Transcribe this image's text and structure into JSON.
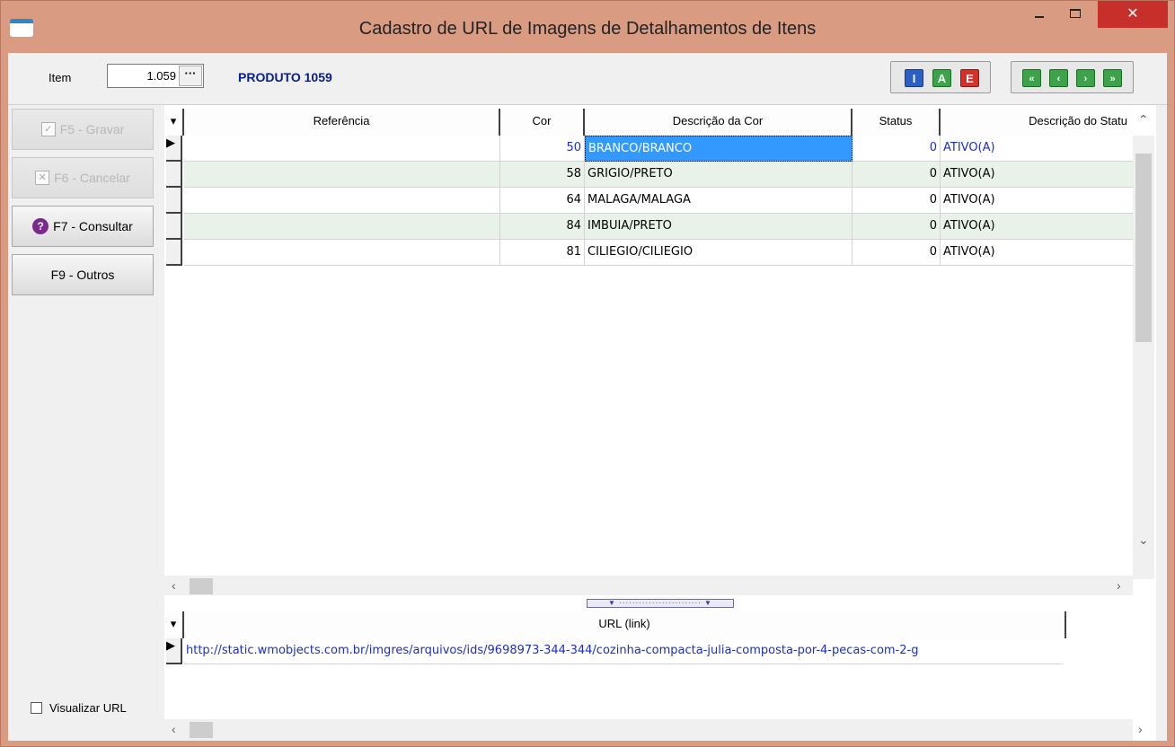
{
  "window": {
    "title": "Cadastro de URL de Imagens de Detalhamentos de Itens",
    "minimize_icon": "minimize-icon",
    "maximize_icon": "maximize-icon",
    "close_label": "✕"
  },
  "header": {
    "item_label": "Item",
    "item_value": "1.059",
    "lookup_label": "···",
    "product_name": "PRODUTO 1059"
  },
  "toolbar": {
    "mode_buttons": [
      {
        "label": "I",
        "color": "#2b5fc4"
      },
      {
        "label": "A",
        "color": "#3ca34a"
      },
      {
        "label": "E",
        "color": "#d3322c"
      }
    ],
    "nav_buttons": [
      {
        "label": "«",
        "icon": "first-record-icon"
      },
      {
        "label": "‹",
        "icon": "previous-record-icon"
      },
      {
        "label": "›",
        "icon": "next-record-icon"
      },
      {
        "label": "»",
        "icon": "last-record-icon"
      }
    ]
  },
  "sidebar": {
    "buttons": [
      {
        "label": "F5 - Gravar",
        "enabled": false,
        "icon": "check-icon"
      },
      {
        "label": "F6 - Cancelar",
        "enabled": false,
        "icon": "x-icon"
      },
      {
        "label": "F7 - Consultar",
        "enabled": true,
        "icon": "help-icon"
      },
      {
        "label": "F9 - Outros",
        "enabled": true
      }
    ],
    "visualizar_url_label": "Visualizar URL",
    "visualizar_url_checked": false
  },
  "grid": {
    "columns": [
      "Referência",
      "Cor",
      "Descrição da Cor",
      "Status",
      "Descrição do Statu"
    ],
    "rows": [
      {
        "referencia": "",
        "cor": "50",
        "descricao_cor": "BRANCO/BRANCO",
        "status": "0",
        "descricao_status": "ATIVO(A)"
      },
      {
        "referencia": "",
        "cor": "58",
        "descricao_cor": "GRIGIO/PRETO",
        "status": "0",
        "descricao_status": "ATIVO(A)"
      },
      {
        "referencia": "",
        "cor": "64",
        "descricao_cor": "MALAGA/MALAGA",
        "status": "0",
        "descricao_status": "ATIVO(A)"
      },
      {
        "referencia": "",
        "cor": "84",
        "descricao_cor": "IMBUIA/PRETO",
        "status": "0",
        "descricao_status": "ATIVO(A)"
      },
      {
        "referencia": "",
        "cor": "81",
        "descricao_cor": "CILIEGIO/CILIEGIO",
        "status": "0",
        "descricao_status": "ATIVO(A)"
      }
    ],
    "selected_row": 0
  },
  "url_grid": {
    "column": "URL (link)",
    "rows": [
      {
        "url": "http://static.wmobjects.com.br/imgres/arquivos/ids/9698973-344-344/cozinha-compacta-julia-composta-por-4-pecas-com-2-g"
      }
    ]
  }
}
